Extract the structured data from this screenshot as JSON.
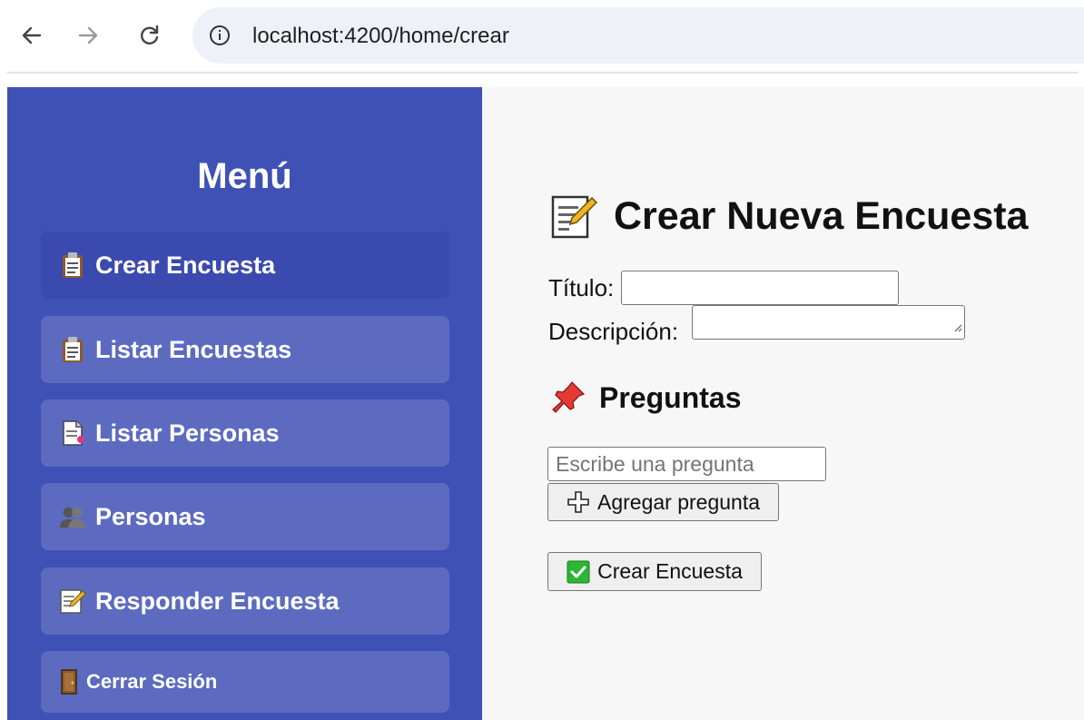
{
  "browser": {
    "url": "localhost:4200/home/crear",
    "icons": [
      "back-arrow-icon",
      "forward-arrow-icon",
      "reload-icon",
      "site-info-icon"
    ]
  },
  "sidebar": {
    "title": "Menú",
    "items": [
      {
        "label": "Crear Encuesta",
        "icon": "clipboard-icon",
        "active": true
      },
      {
        "label": "Listar Encuestas",
        "icon": "clipboard-icon",
        "active": false
      },
      {
        "label": "Listar Personas",
        "icon": "page-icon",
        "active": false
      },
      {
        "label": "Personas",
        "icon": "people-icon",
        "active": false
      },
      {
        "label": "Responder Encuesta",
        "icon": "memo-icon",
        "active": false
      },
      {
        "label": "Cerrar Sesión",
        "icon": "door-icon",
        "active": false
      }
    ]
  },
  "form": {
    "heading": "Crear Nueva Encuesta",
    "titulo_label": "Título:",
    "titulo_value": "",
    "descripcion_label": "Descripción:",
    "descripcion_value": "",
    "preguntas_heading": "Preguntas",
    "pregunta_placeholder": "Escribe una pregunta",
    "add_question_label": "Agregar pregunta",
    "submit_label": "Crear Encuesta"
  },
  "colors": {
    "sidebar_bg": "#3f51b5",
    "menu_item_bg": "#5c6bc0",
    "menu_item_active_bg": "#3a4aaf",
    "main_bg": "#f7f7f7",
    "check_green": "#2db534"
  }
}
